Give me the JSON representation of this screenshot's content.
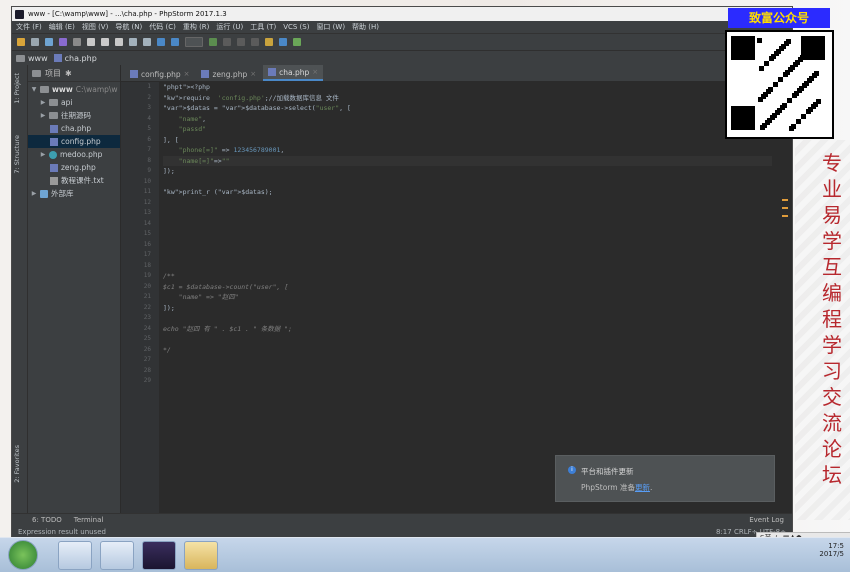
{
  "window": {
    "title": "www - [C:\\wamp\\www] - ...\\cha.php - PhpStorm 2017.1.3"
  },
  "menu": [
    "文件 (F)",
    "编辑 (E)",
    "视图 (V)",
    "导航 (N)",
    "代码 (C)",
    "重构 (R)",
    "运行 (U)",
    "工具 (T)",
    "VCS (S)",
    "窗口 (W)",
    "帮助 (H)"
  ],
  "breadcrumbs": [
    "www",
    "cha.php"
  ],
  "project": {
    "label": "项目",
    "root": "www",
    "root_path": "C:\\wamp\\w",
    "items": [
      {
        "label": "api",
        "type": "folder"
      },
      {
        "label": "往期源码",
        "type": "folder"
      },
      {
        "label": "cha.php",
        "type": "php"
      },
      {
        "label": "config.php",
        "type": "php",
        "selected": true
      },
      {
        "label": "medoo.php",
        "type": "class"
      },
      {
        "label": "zeng.php",
        "type": "php"
      },
      {
        "label": "教程课件.txt",
        "type": "txt"
      },
      {
        "label": "外部库",
        "type": "lib"
      }
    ]
  },
  "left_strip": {
    "project": "1: Project",
    "structure": "7: Structure",
    "favorites": "2: Favorites"
  },
  "tabs": [
    {
      "label": "config.php",
      "active": false
    },
    {
      "label": "zeng.php",
      "active": false
    },
    {
      "label": "cha.php",
      "active": true
    }
  ],
  "gutter": [
    "1",
    "2",
    "3",
    "4",
    "5",
    "6",
    "7",
    "8",
    "9",
    "10",
    "11",
    "12",
    "13",
    "14",
    "15",
    "16",
    "17",
    "18",
    "19",
    "20",
    "21",
    "22",
    "23",
    "24",
    "25",
    "26",
    "27",
    "28",
    "29"
  ],
  "code": [
    "<?php",
    "require  'config.php';//加载数据库信息 文件",
    "$datas = $database->select(\"user\", [",
    "    \"name\",",
    "    \"passd\"",
    "], [",
    "    \"phone[=]\" => 123456789001,",
    "    \"name[=]\"=>\"\"",
    "]);",
    "",
    "print_r ($datas);",
    "",
    "",
    "",
    "",
    "",
    "",
    "",
    "/**",
    "$c1 = $database->count(\"user\", [",
    "    \"name\" => \"赵四\"",
    "]);",
    "",
    "echo \"赵四 有 \" . $c1 . \" 条数据 \";",
    "",
    "*/",
    "",
    "",
    ""
  ],
  "bottom_tabs": {
    "todo": "6: TODO",
    "terminal": "Terminal"
  },
  "status": {
    "message": "Expression result unused",
    "position": "8:17",
    "line_sep": "CRLF÷",
    "encoding": "UTF-8÷",
    "event_log": "Event Log"
  },
  "notification": {
    "title": "平台和插件更新",
    "body": "PhpStorm 准备",
    "link": "更新",
    "suffix": "."
  },
  "overlay": {
    "banner": "致富公众号",
    "side_text": "专业易学互编程学习交流论坛"
  },
  "tray": {
    "time": "17:5",
    "date": "2017/5"
  },
  "ime": "S英ノ·,▦♟☗"
}
